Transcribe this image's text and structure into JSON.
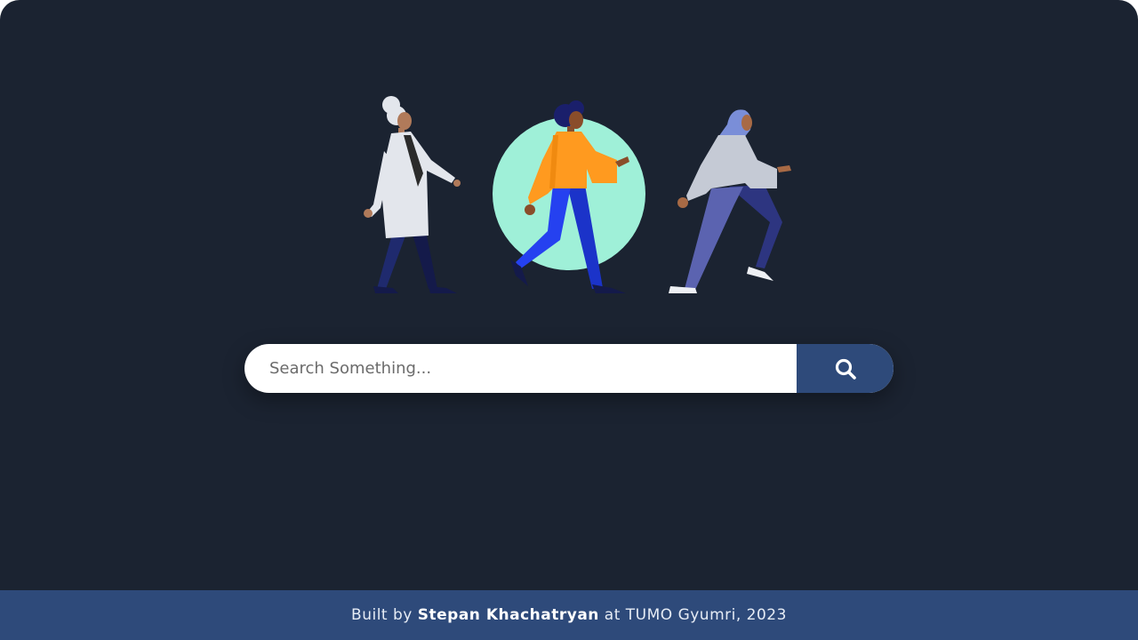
{
  "search": {
    "placeholder": "Search Something...",
    "button_icon": "search-icon"
  },
  "hero": {
    "illustration": "three-people-walking",
    "circle_color": "#9ff0d8"
  },
  "footer": {
    "prefix": "Built by ",
    "author": "Stepan Khachatryan",
    "suffix": " at TUMO Gyumri, 2023"
  },
  "colors": {
    "background": "#1b2331",
    "accent": "#2e4a7a"
  }
}
